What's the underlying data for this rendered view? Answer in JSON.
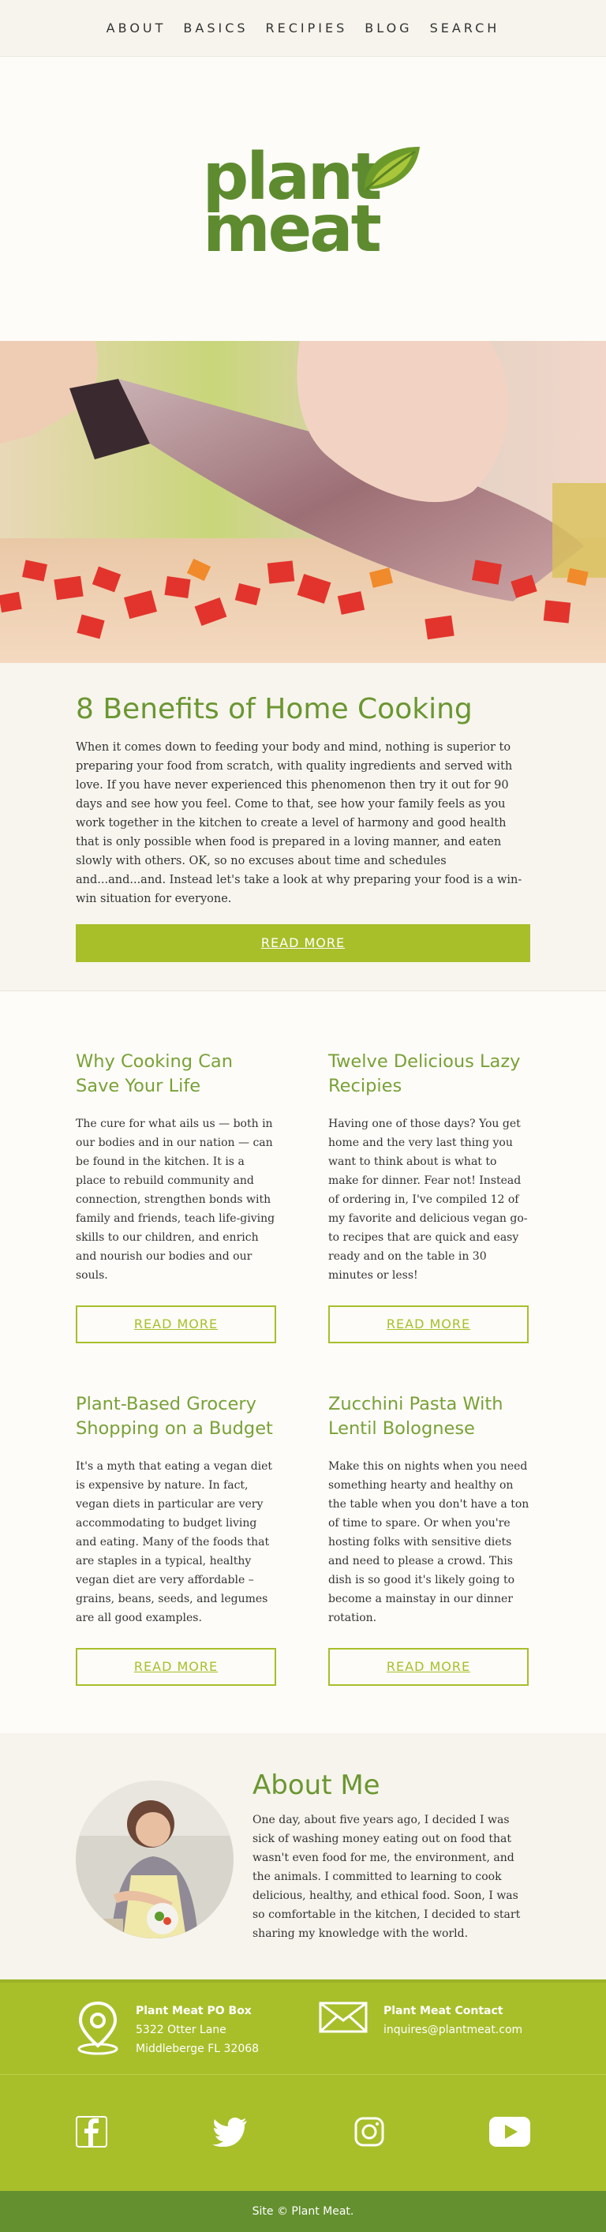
{
  "nav": {
    "items": [
      "ABOUT",
      "BASICS",
      "RECIPIES",
      "BLOG",
      "SEARCH"
    ]
  },
  "logo": {
    "line1": "plant",
    "line2": "meat"
  },
  "feature": {
    "title": "8 Benefits of Home Cooking",
    "body": "When it comes down to feeding your body and mind, nothing is superior to preparing your food from scratch, with quality ingredients and served with love.  If you have never experienced this phenomenon then try it out for 90 days and see how you feel. Come to that, see how your family feels as you work together in the kitchen to create a level of harmony and good health that is only possible when food is prepared in a loving manner, and eaten slowly with others. OK, so no excuses about time and schedules and...and...and. Instead let's take a look at why preparing your food is a win-win situation for everyone.",
    "button": "READ MORE"
  },
  "cards": [
    {
      "title": "Why Cooking Can Save Your Life",
      "body": "The cure for what ails us — both in our bodies and in our nation — can be found in the kitchen. It is a place to rebuild community and connection, strengthen bonds with family and friends, teach life-giving skills to our children, and enrich and nourish our bodies and our souls.",
      "button": "READ MORE"
    },
    {
      "title": "Twelve Delicious Lazy Recipies",
      "body": "Having one of those days? You get home and the very last thing you want to think about is what to make for dinner. Fear not! Instead of ordering in, I've compiled 12 of my favorite and delicious vegan go-to recipes that are quick and easy ready and on the table in 30 minutes or less!",
      "button": "READ MORE"
    },
    {
      "title": "Plant-Based Grocery Shopping on a Budget",
      "body": "It's a myth that eating a vegan diet is expensive by nature. In fact, vegan diets in particular are very accommodating to budget living and eating. Many of the foods that are staples in a typical, healthy vegan diet are very affordable – grains, beans, seeds, and legumes are all good examples.",
      "button": "READ MORE"
    },
    {
      "title": "Zucchini Pasta With Lentil Bolognese",
      "body": "Make this on nights when you need something hearty and healthy on the table when you don't have a ton of time to spare. Or when you're hosting folks with sensitive diets and need to please a crowd. This dish is so good it's likely going to become a mainstay in our dinner rotation.",
      "button": "READ MORE"
    }
  ],
  "about": {
    "title": "About Me",
    "body": "One day, about five years ago, I decided I was sick of washing money eating out on food that wasn't even food for me, the environment, and the animals. I committed to learning to cook delicious, healthy, and ethical food. Soon, I was so comfortable in the kitchen, I decided to start sharing my knowledge with the world."
  },
  "contact": {
    "address_title": "Plant Meat PO Box",
    "address_line1": "5322 Otter Lane",
    "address_line2": "Middleberge FL 32068",
    "email_title": "Plant Meat Contact",
    "email": "inquires@plantmeat.com"
  },
  "social": {
    "icons": [
      "facebook-icon",
      "twitter-icon",
      "instagram-icon",
      "youtube-icon"
    ]
  },
  "footer": {
    "text": "Site © Plant Meat."
  },
  "colors": {
    "brand_green": "#5e8b2f",
    "accent_lime": "#a8bf2a",
    "footer_green": "#64902f",
    "cream": "#f6f4ec"
  }
}
